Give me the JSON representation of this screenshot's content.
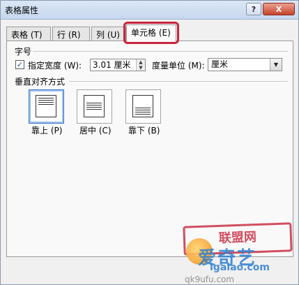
{
  "window": {
    "title": "表格属性",
    "help_label": "?",
    "close_label": "X"
  },
  "tabs": [
    {
      "label": "表格 (T)"
    },
    {
      "label": "行 (R)"
    },
    {
      "label": "列 (U)"
    },
    {
      "label": "单元格 (E)"
    }
  ],
  "size_group": {
    "label": "字号",
    "width_checked": true,
    "width_label": "指定宽度 (W):",
    "width_value": "3.01 厘米",
    "unit_label": "度量单位 (M):",
    "unit_value": "厘米"
  },
  "vertical_align": {
    "label": "垂直对齐方式",
    "options": [
      {
        "label": "靠上 (P)",
        "selected": true
      },
      {
        "label": "居中 (C)",
        "selected": false
      },
      {
        "label": "靠下 (B)",
        "selected": false
      }
    ]
  },
  "watermark": {
    "stamp": "联盟网",
    "brand": "爱奇艺",
    "url": "igaiao.com",
    "url2": "qk9ufu.com"
  },
  "colors": {
    "highlight": "#c8243a",
    "accent": "#3a77c7"
  }
}
